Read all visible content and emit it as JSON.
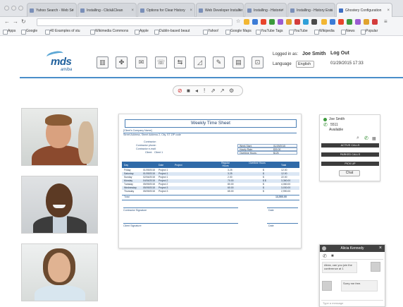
{
  "browser": {
    "tabs": [
      "Yahoo Search - Web Se",
      "Installing - Click&Clean",
      "Options for Clear History",
      "Web Developer Installer",
      "Installing - Historie",
      "Installing - History Eras",
      "Ghostery Configuration"
    ],
    "bookmarks": [
      "Apps",
      "Google",
      "40 Examples of stu",
      "Wikimedia Commons",
      "Apple",
      "Dublin-based beaut",
      "Yahoo!",
      "Google Maps",
      "YouTube Tags",
      "YouTube",
      "Wikipedia",
      "News",
      "Popular"
    ],
    "icon_colors": [
      "#f2b632",
      "#3b7bd6",
      "#e8452c",
      "#3c9a3c",
      "#9a5bd1",
      "#e0a22e",
      "#d33c3c",
      "#2f9fd8",
      "#4a4a4a"
    ]
  },
  "header": {
    "logo_text": "mds",
    "logo_sub": "amiba",
    "tools": [
      "book-icon",
      "group-icon",
      "mail-icon",
      "phone-icon",
      "call-transfer-icon",
      "chart-icon",
      "wrench-icon",
      "building-icon",
      "contact-card-icon"
    ],
    "logged_in_label": "Logged in as:",
    "user": "Joe Smith",
    "logout": "Log Out",
    "language_label": "Language",
    "language": "English",
    "datetime": "01/29/2015 17:33"
  },
  "call_controls": [
    "mute-video-icon",
    "video-icon",
    "speaker-icon",
    "mic-icon",
    "transfer-icon",
    "pin-icon",
    "settings-icon"
  ],
  "document": {
    "title": "Weekly Time Sheet",
    "company": "[Client's Company Name]",
    "address": "Street Address, Street Address 2, City, ST ZIP code",
    "fields": [
      "Contractor:",
      "Contractor phone:",
      "Contractor e-mail:",
      "Client:"
    ],
    "client_value": "Client 1",
    "summary": [
      {
        "label": "Week Start:",
        "value": "01/29/2015"
      },
      {
        "label": "Hourly Rate:",
        "value": "$30.00"
      },
      {
        "label": "Overtime Hours:",
        "value": "$125"
      }
    ],
    "columns": [
      "Day",
      "Date",
      "Project",
      "Regular Hours",
      "Overtime Hours",
      "Total"
    ],
    "rows": [
      {
        "day": "Friday",
        "date": "01/09/2015",
        "project": "Project 1",
        "hours": "3.25",
        "ot": "$",
        "total": "12.00"
      },
      {
        "day": "Saturday",
        "date": "01/09/2015",
        "project": "Project 1",
        "hours": "3.25",
        "ot": "$",
        "total": "12.00"
      },
      {
        "day": "Sunday",
        "date": "02/04/2015",
        "project": "Project 1",
        "hours": "2.00",
        "ot": "$",
        "total": "22.00"
      },
      {
        "day": "Monday",
        "date": "04/04/2015",
        "project": "Project 2",
        "hours": "70.00",
        "ot": "$ $",
        "total": "3,360.00"
      },
      {
        "day": "Tuesday",
        "date": "05/09/2015",
        "project": "Project 2",
        "hours": "80.00",
        "ot": "$",
        "total": "4,060.00"
      },
      {
        "day": "Wednesday",
        "date": "05/09/2015",
        "project": "Project 3",
        "hours": "60.00",
        "ot": "$",
        "total": "3,030.00"
      },
      {
        "day": "Thursday",
        "date": "05/09/2015",
        "project": "Project 3",
        "hours": "65.00",
        "ot": "$",
        "total": "2,990.00"
      }
    ],
    "total_label": "Total",
    "total_value": "13,500.00",
    "contractor_signature": "Contractor Signature",
    "client_signature": "Client Signature",
    "date_label": "Date"
  },
  "contact": {
    "name": "Joe Smith",
    "ext": "5511",
    "status": "Available",
    "active_calls": "ACTIVE CALLS",
    "parked_calls": "PARKED CALLS",
    "pick_up": "PICK UP",
    "chat": "Chat"
  },
  "chat": {
    "title": "Alicia Kennedy",
    "message1": "Alicia, can you join the conference at 1",
    "message2": "Sorry me free.",
    "placeholder": "Type a message"
  },
  "colors": {
    "accent": "#4a8ec9",
    "brand": "#1e5f9c",
    "table_header": "#2f6aa8",
    "row_alt": "#dbe7f4"
  }
}
